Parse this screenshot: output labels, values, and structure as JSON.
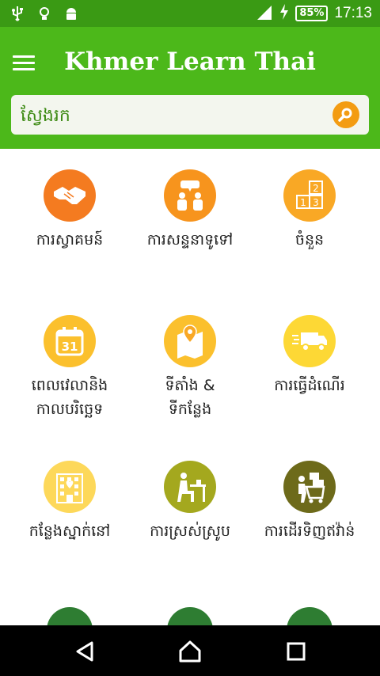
{
  "status_bar": {
    "icons": [
      "usb-icon",
      "bulb-icon",
      "android-icon",
      "signal-icon",
      "charging-icon"
    ],
    "battery": "85%",
    "time": "17:13"
  },
  "app_bar": {
    "title": "Khmer Learn Thai",
    "search_placeholder": "ស្វែងរក"
  },
  "colors": {
    "status_bar": "#3a9a14",
    "app_bar": "#4cb81a",
    "orange": "#f47b20",
    "amber": "#f9a825",
    "yellow": "#fbc02d",
    "olive": "#8a9a1a",
    "dark_olive": "#6d6a1a",
    "green": "#2e7d32"
  },
  "categories": [
    {
      "label": "ការស្វាគមន៍",
      "icon": "handshake-icon",
      "color": "#f47b20"
    },
    {
      "label": "ការសន្ទនាទូទៅ",
      "icon": "conversation-icon",
      "color": "#f7941d"
    },
    {
      "label": "ចំនួន",
      "icon": "number-blocks-icon",
      "color": "#f9a825"
    },
    {
      "label": "ពេលវេលានិង\nកាលបរិច្ឆេទ",
      "icon": "calendar-icon",
      "color": "#fbc02d"
    },
    {
      "label": "ទីតាំង &\nទីកន្លែង",
      "icon": "map-pin-icon",
      "color": "#fbc02d"
    },
    {
      "label": "ការធ្វើដំណើរ",
      "icon": "truck-icon",
      "color": "#fdd835"
    },
    {
      "label": "កន្លែងស្នាក់នៅ",
      "icon": "hotel-icon",
      "color": "#fdd85a"
    },
    {
      "label": "ការស្រស់ស្រូប",
      "icon": "dining-icon",
      "color": "#a4a81e"
    },
    {
      "label": "ការដើរទិញឥវ៉ាន់",
      "icon": "shopping-icon",
      "color": "#6d6a1a"
    }
  ],
  "nav_bar": [
    "back-icon",
    "home-icon",
    "recents-icon"
  ]
}
